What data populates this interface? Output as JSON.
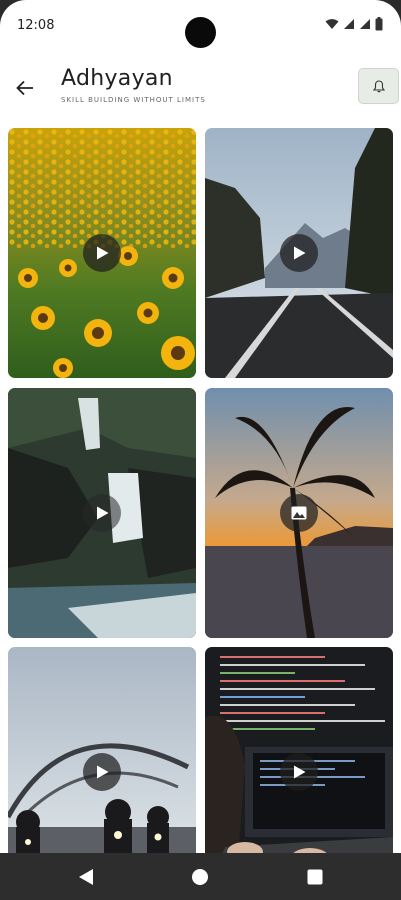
{
  "status": {
    "time": "12:08"
  },
  "header": {
    "title": "Adhyayan",
    "subtitle": "SKILL BUILDING WITHOUT LIMITS"
  },
  "icons": {
    "back": "arrow-left-icon",
    "notifications": "bell-icon",
    "video": "play-icon",
    "image": "image-icon",
    "nav_back": "triangle-back-icon",
    "nav_home": "circle-home-icon",
    "nav_recents": "square-recents-icon"
  },
  "grid": {
    "items": [
      {
        "subject": "sunflower-field",
        "media_type": "video"
      },
      {
        "subject": "mountain-road",
        "media_type": "video"
      },
      {
        "subject": "waterfall",
        "media_type": "video"
      },
      {
        "subject": "palm-tree-sunset",
        "media_type": "image"
      },
      {
        "subject": "motorcycles-on-bridge",
        "media_type": "video"
      },
      {
        "subject": "coding-laptop",
        "media_type": "video"
      }
    ]
  },
  "colors": {
    "background": "#ffffff",
    "header_button_bg": "#e8ece6",
    "nav_bar": "#2d2d2d"
  }
}
